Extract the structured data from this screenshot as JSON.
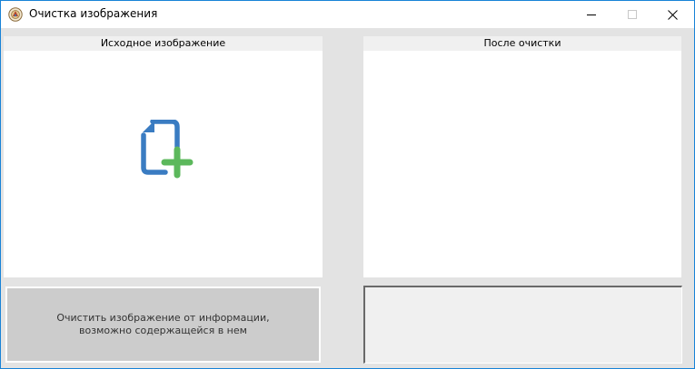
{
  "window": {
    "title": "Очистка изображения"
  },
  "icons": {
    "app": "app-icon",
    "minimize": "minimize-icon",
    "maximize": "maximize-icon",
    "close": "close-icon",
    "add_file": "add-file-icon"
  },
  "panels": {
    "source": {
      "header": "Исходное изображение"
    },
    "result": {
      "header": "После очистки"
    }
  },
  "actions": {
    "clean_label": "Очистить изображение от информации, возможно содержащейся в нем"
  },
  "colors": {
    "file_icon": "#3a7cc2",
    "plus_icon": "#5cb85c",
    "window_border": "#1883d7"
  }
}
